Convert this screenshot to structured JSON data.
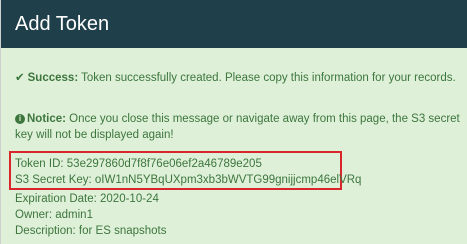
{
  "dialog": {
    "title": "Add Token"
  },
  "success": {
    "label": "Success:",
    "message": " Token successfully created. Please copy this information for your records."
  },
  "notice": {
    "label": "Notice:",
    "message": " Once you close this message or navigate away from this page, the S3 secret key will not be displayed again!"
  },
  "token": {
    "id_line": "Token ID: 53e297860d7f8f76e06ef2a46789e205",
    "secret_line": "S3 Secret Key: oIW1nN5YBqUXpm3xb3bWVTG99gnijjcmp46elVRq",
    "expiration_line": "Expiration Date: 2020-10-24",
    "owner_line": "Owner: admin1",
    "description_line": "Description: for ES snapshots"
  },
  "colors": {
    "header_bg": "#1f3f4a",
    "alert_bg": "#dff0d8",
    "alert_text": "#3c763d",
    "highlight_border": "#d9262c"
  }
}
